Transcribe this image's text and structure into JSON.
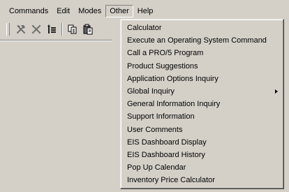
{
  "menubar": {
    "items": [
      "Commands",
      "Edit",
      "Modes",
      "Other",
      "Help"
    ],
    "open_item": "Other"
  },
  "toolbar": {
    "icons": [
      "tools-icon",
      "delete-icon",
      "list-icon",
      "copy-icon",
      "paste-icon"
    ]
  },
  "other_menu": {
    "items": [
      {
        "label": "Calculator"
      },
      {
        "label": "Execute an Operating System Command"
      },
      {
        "label": "Call a PRO/5 Program"
      },
      {
        "label": "Product Suggestions"
      },
      {
        "label": "Application Options Inquiry"
      },
      {
        "label": "Global Inquiry",
        "submenu": true
      },
      {
        "label": "General Information Inquiry"
      },
      {
        "label": "Support Information"
      },
      {
        "label": "User Comments"
      },
      {
        "label": "EIS Dashboard Display"
      },
      {
        "label": "EIS Dashboard History"
      },
      {
        "label": "Pop Up Calendar"
      },
      {
        "label": "Inventory Price Calculator"
      }
    ]
  },
  "colors": {
    "face": "#d4d0c8",
    "shadow": "#808080",
    "highlight": "#ffffff",
    "icon_gray": "#6e6e6e"
  }
}
